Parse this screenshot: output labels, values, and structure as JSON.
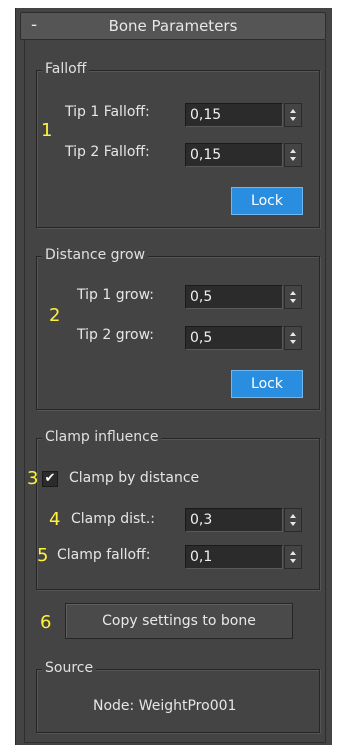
{
  "rollout": {
    "collapse_symbol": "-",
    "title": "Bone Parameters"
  },
  "falloff": {
    "group_label": "Falloff",
    "marker": "1",
    "tip1_label": "Tip 1 Falloff:",
    "tip1_value": "0,15",
    "tip2_label": "Tip 2 Falloff:",
    "tip2_value": "0,15",
    "lock_label": "Lock"
  },
  "distance_grow": {
    "group_label": "Distance grow",
    "marker": "2",
    "tip1_label": "Tip 1 grow:",
    "tip1_value": "0,5",
    "tip2_label": "Tip 2 grow:",
    "tip2_value": "0,5",
    "lock_label": "Lock"
  },
  "clamp": {
    "group_label": "Clamp influence",
    "marker_checkbox": "3",
    "checkbox_label": "Clamp by distance",
    "checked": true,
    "marker_dist": "4",
    "dist_label": "Clamp dist.:",
    "dist_value": "0,3",
    "marker_falloff": "5",
    "falloff_label": "Clamp falloff:",
    "falloff_value": "0,1"
  },
  "copy": {
    "marker": "6",
    "button_label": "Copy settings to bone"
  },
  "source": {
    "group_label": "Source",
    "node_text": "Node: WeightPro001"
  },
  "colors": {
    "accent": "#2a8ee0",
    "marker": "#fff23c",
    "panel": "#444444"
  }
}
